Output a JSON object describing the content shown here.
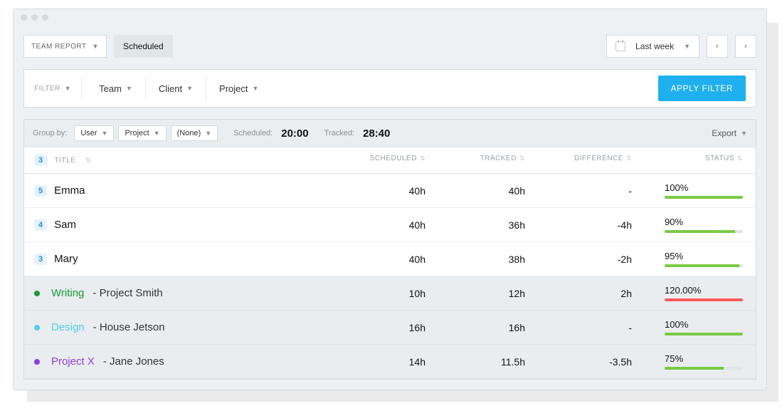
{
  "header": {
    "report_select": "TEAM REPORT",
    "scheduled_button": "Scheduled",
    "period_label": "Last week"
  },
  "filter": {
    "label": "FILTER",
    "filters": [
      "Team",
      "Client",
      "Project"
    ],
    "apply": "APPLY FILTER"
  },
  "groupbar": {
    "label": "Group by:",
    "groups": [
      "User",
      "Project",
      "(None)"
    ],
    "scheduled_label": "Scheduled:",
    "scheduled_val": "20:00",
    "tracked_label": "Tracked:",
    "tracked_val": "28:40",
    "export": "Export"
  },
  "columns": {
    "count": "3",
    "title": "TITLE",
    "scheduled": "SCHEDULED",
    "tracked": "TRACKED",
    "difference": "DIFFERENCE",
    "status": "STATUS"
  },
  "users": [
    {
      "count": "5",
      "name": "Emma",
      "scheduled": "40h",
      "tracked": "40h",
      "diff": "-",
      "status": "100%",
      "pct": 100,
      "red": false
    },
    {
      "count": "4",
      "name": "Sam",
      "scheduled": "40h",
      "tracked": "36h",
      "diff": "-4h",
      "status": "90%",
      "pct": 90,
      "red": false
    },
    {
      "count": "3",
      "name": "Mary",
      "scheduled": "40h",
      "tracked": "38h",
      "diff": "-2h",
      "status": "95%",
      "pct": 95,
      "red": false
    }
  ],
  "projects": [
    {
      "color": "#179b3a",
      "main": "Writing",
      "sub": " - Project Smith",
      "scheduled": "10h",
      "tracked": "12h",
      "diff": "2h",
      "status": "120.00%",
      "pct": 100,
      "red": true
    },
    {
      "color": "#55cdf2",
      "main": "Design",
      "sub": " - House Jetson",
      "scheduled": "16h",
      "tracked": "16h",
      "diff": "-",
      "status": "100%",
      "pct": 100,
      "red": false
    },
    {
      "color": "#8a3fe0",
      "main": "Project X",
      "sub": " - Jane Jones",
      "scheduled": "14h",
      "tracked": "11.5h",
      "diff": "-3.5h",
      "status": "75%",
      "pct": 75,
      "red": false
    }
  ]
}
